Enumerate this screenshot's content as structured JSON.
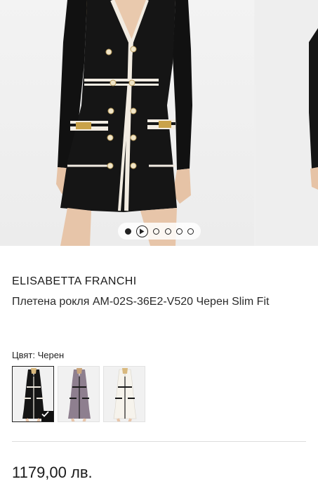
{
  "gallery": {
    "slide_count": 5,
    "active_index": 0,
    "has_video": true
  },
  "product": {
    "brand": "ELISABETTA FRANCHI",
    "title": "Плетена рокля AM-02S-36E2-V520 Черен Slim Fit",
    "color_label": "Цвят: Черен",
    "price": "1179,00 лв."
  },
  "swatches": [
    {
      "dress_color": "#151515",
      "trim_color": "#f2ece2",
      "selected": true
    },
    {
      "dress_color": "#8e7f8f",
      "trim_color": "#1a1a1a",
      "selected": false
    },
    {
      "dress_color": "#f2efe8",
      "trim_color": "#1a1a1a",
      "selected": false
    }
  ],
  "colors": {
    "check_bg": "#111111",
    "divider": "#dcdcdc"
  }
}
